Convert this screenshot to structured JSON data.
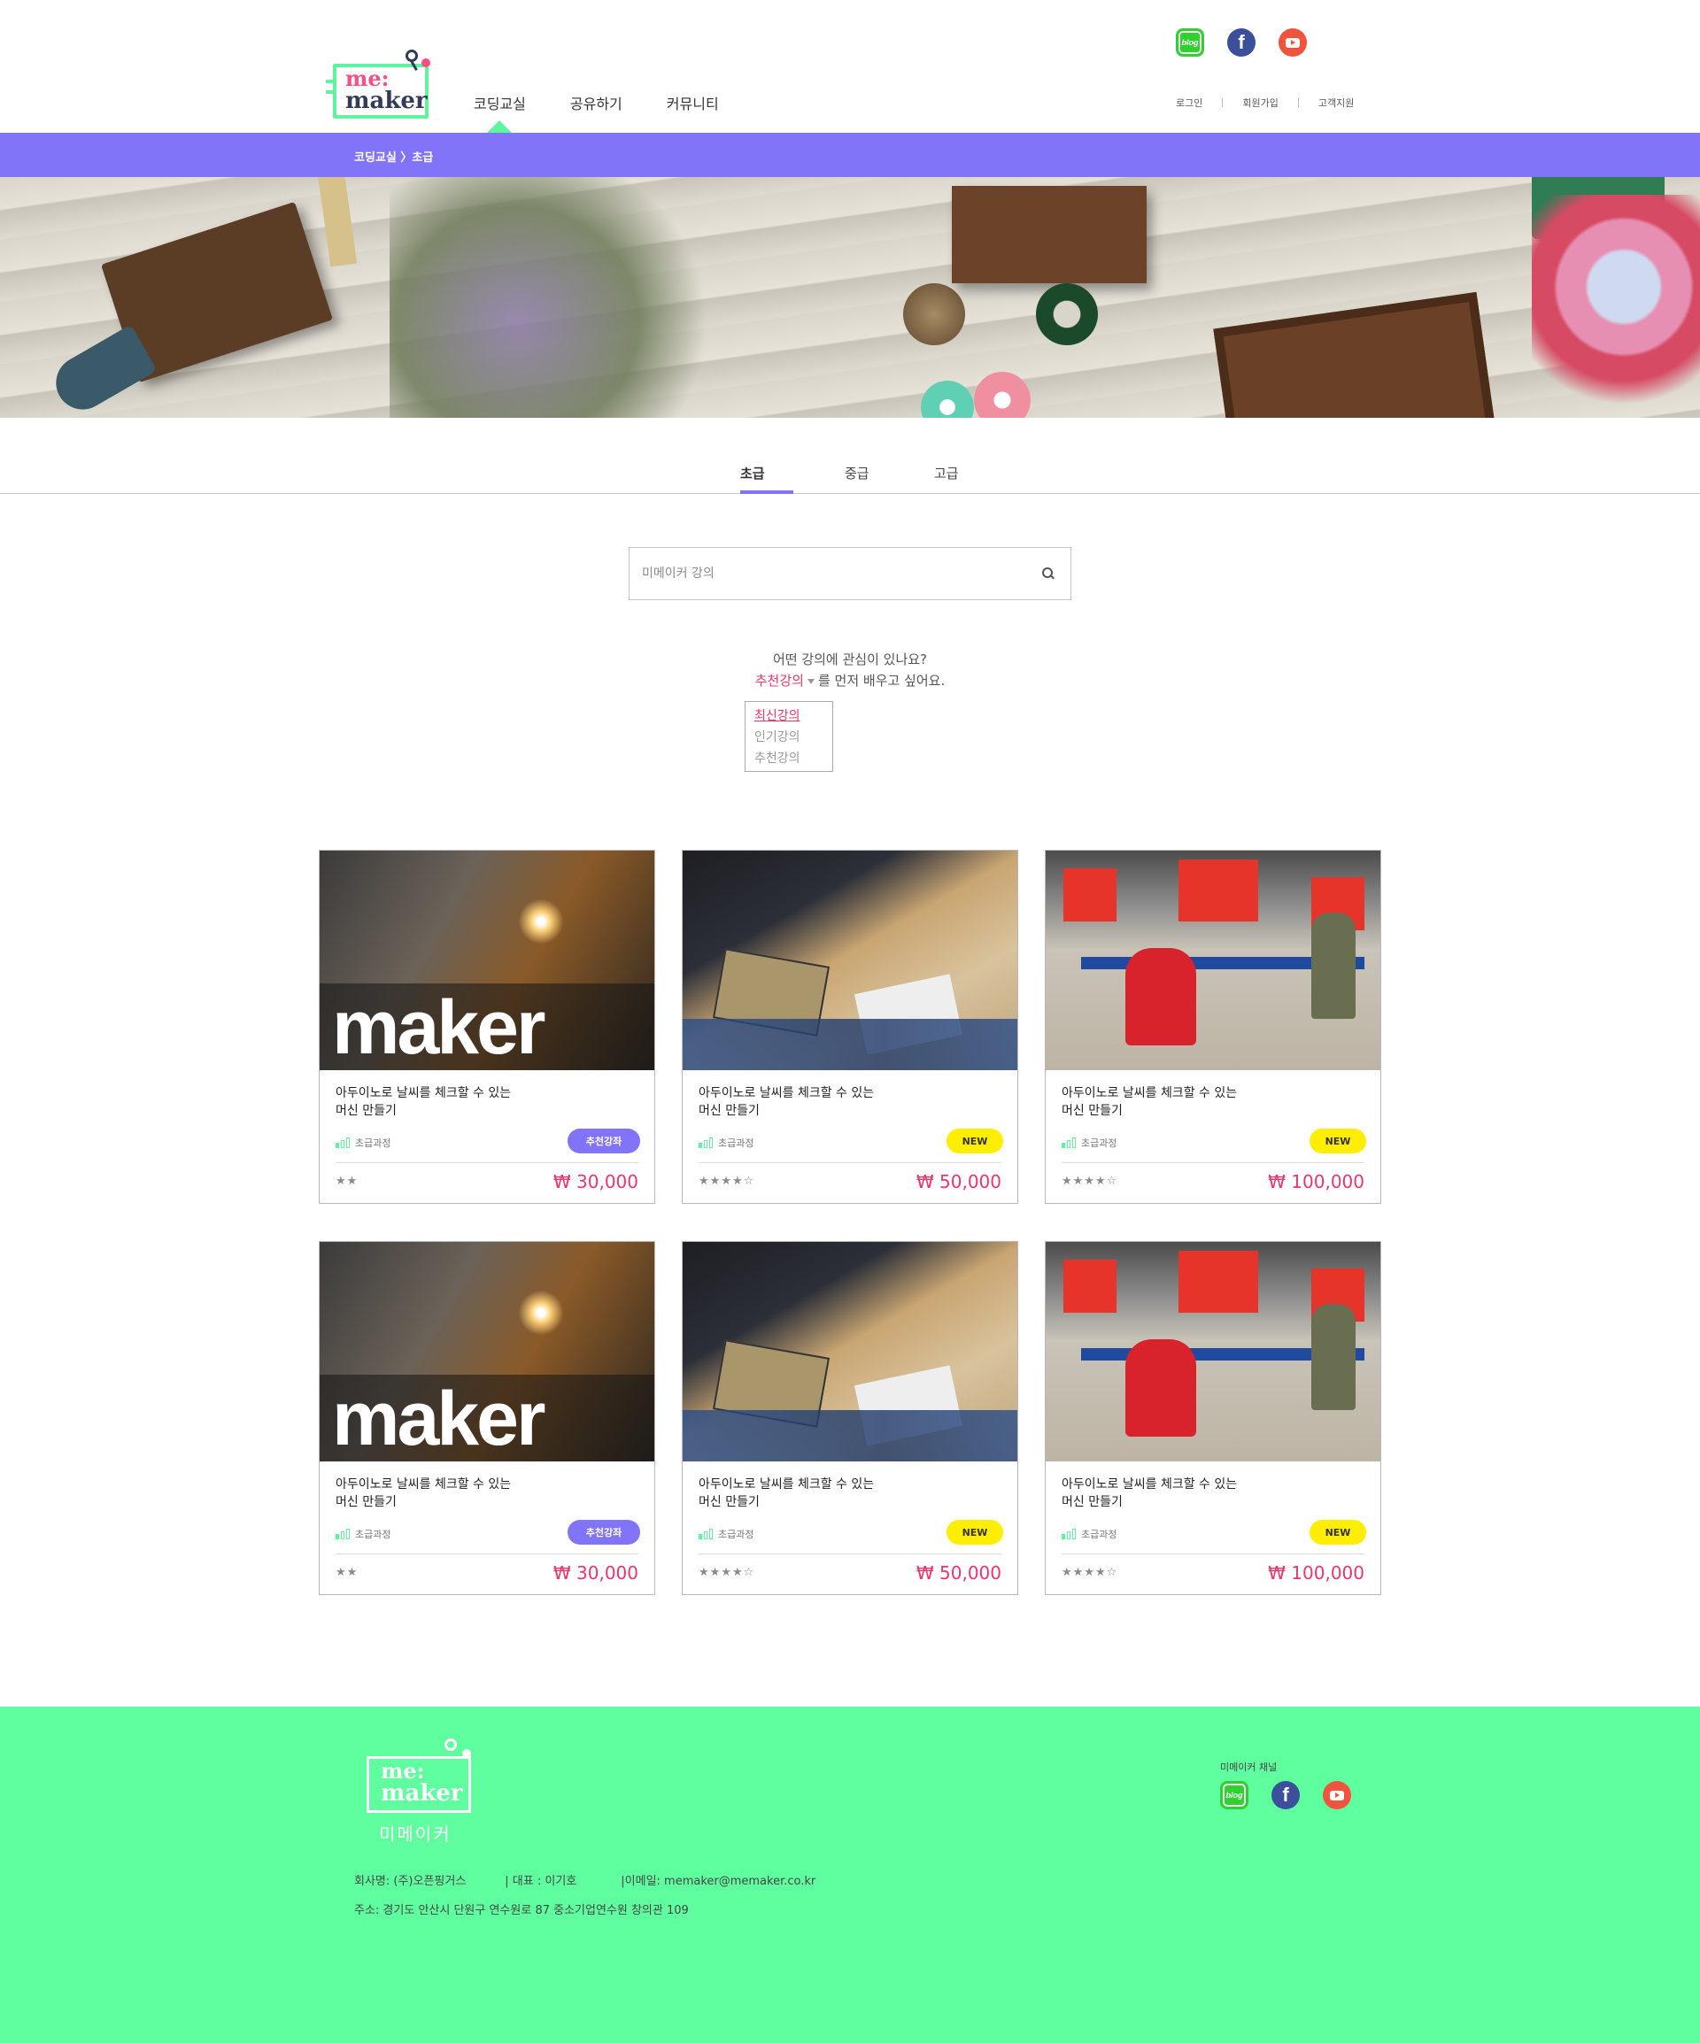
{
  "logo": {
    "line1": "me:",
    "line2": "maker"
  },
  "gnb": [
    "코딩교실",
    "공유하기",
    "커뮤니티"
  ],
  "util": [
    "로그인",
    "회원가입",
    "고객지원"
  ],
  "social": {
    "blog_label": "blog",
    "fb_label": "f"
  },
  "breadcrumb": "코딩교실 〉초급",
  "tabs": [
    "초급",
    "중급",
    "고급"
  ],
  "search": {
    "placeholder": "미메이커 강의"
  },
  "question": "어떤 강의에 관심이 있나요?",
  "pref": {
    "selected": "추천강의",
    "suffix": "를 먼저 배우고 싶어요."
  },
  "dropdown": [
    "최신강의",
    "인기강의",
    "추천강의"
  ],
  "cards": [
    {
      "thumb_word": "maker",
      "title1": "아두이노로 날씨를 체크할 수 있는",
      "title2": "머신 만들기",
      "level": "초급과정",
      "badge": "추천강좌",
      "stars": "★★",
      "price": "₩ 30,000"
    },
    {
      "title1": "아두이노로 날씨를 체크할 수 있는",
      "title2": "머신 만들기",
      "level": "초급과정",
      "badge": "NEW",
      "stars": "★★★★☆",
      "price": "₩ 50,000"
    },
    {
      "title1": "아두이노로 날씨를 체크할 수 있는",
      "title2": "머신 만들기",
      "level": "초급과정",
      "badge": "NEW",
      "stars": "★★★★☆",
      "price": "₩ 100,000"
    },
    {
      "thumb_word": "maker",
      "title1": "아두이노로 날씨를 체크할 수 있는",
      "title2": "머신 만들기",
      "level": "초급과정",
      "badge": "추천강좌",
      "stars": "★★",
      "price": "₩ 30,000"
    },
    {
      "title1": "아두이노로 날씨를 체크할 수 있는",
      "title2": "머신 만들기",
      "level": "초급과정",
      "badge": "NEW",
      "stars": "★★★★☆",
      "price": "₩ 50,000"
    },
    {
      "title1": "아두이노로 날씨를 체크할 수 있는",
      "title2": "머신 만들기",
      "level": "초급과정",
      "badge": "NEW",
      "stars": "★★★★☆",
      "price": "₩ 100,000"
    }
  ],
  "footer": {
    "logo_line1": "me:",
    "logo_line2": "maker",
    "brand_kr": "미메이커",
    "company": "회사명: (주)오픈핑거스",
    "ceo": "| 대표 : 이기호",
    "email": "|이메일: memaker@memaker.co.kr",
    "address": "주소: 경기도 안산시 단원구 연수원로 87 중소기업연수원 창의관 109",
    "channel_title": "미메이커 채널"
  },
  "colors": {
    "accent_purple": "#8174f8",
    "accent_green": "#5fff9f",
    "price_pink": "#e9376e",
    "badge_yellow": "#ffee00"
  }
}
